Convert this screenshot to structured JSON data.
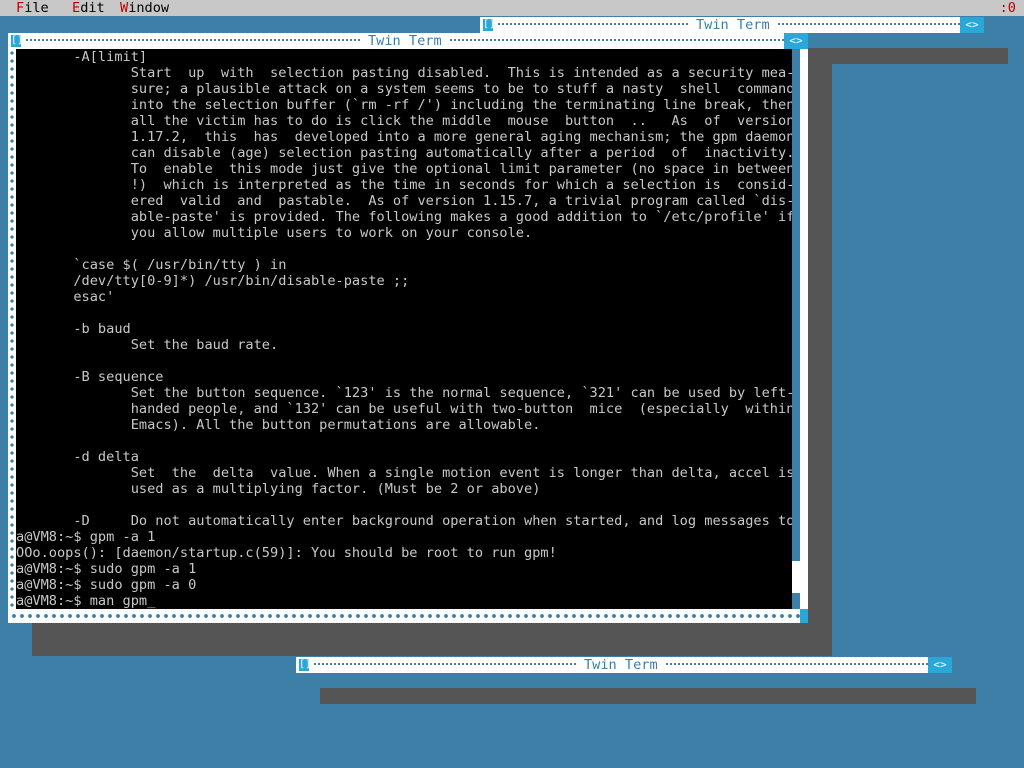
{
  "menu": {
    "file": {
      "hotkey": "F",
      "rest": "ile"
    },
    "edit": {
      "hotkey": "E",
      "rest": "dit"
    },
    "window": {
      "hotkey": "W",
      "rest": "indow"
    },
    "clock": ":0"
  },
  "windows": {
    "top": {
      "title": "Twin Term",
      "close_glyph": "[]",
      "buttons_glyph": "<>"
    },
    "main": {
      "title": "Twin Term",
      "close_glyph": "[]",
      "buttons_glyph": "<>"
    },
    "bottom": {
      "title": "Twin Term",
      "close_glyph": "[]",
      "buttons_glyph": "<>"
    }
  },
  "terminal": {
    "lines": [
      "       -A[limit]",
      "              Start  up  with  selection pasting disabled.  This is intended as a security mea-",
      "              sure; a plausible attack on a system seems to be to stuff a nasty  shell  command",
      "              into the selection buffer (`rm -rf /') including the terminating line break, then",
      "              all the victim has to do is click the middle  mouse  button  ..   As  of  version",
      "              1.17.2,  this  has  developed into a more general aging mechanism; the gpm daemon",
      "              can disable (age) selection pasting automatically after a period  of  inactivity.",
      "              To  enable  this mode just give the optional limit parameter (no space in between",
      "              !)  which is interpreted as the time in seconds for which a selection is  consid-",
      "              ered  valid  and  pastable.  As of version 1.15.7, a trivial program called `dis-",
      "              able-paste' is provided. The following makes a good addition to `/etc/profile' if",
      "              you allow multiple users to work on your console.",
      "",
      "       `case $( /usr/bin/tty ) in",
      "       /dev/tty[0-9]*) /usr/bin/disable-paste ;;",
      "       esac'",
      "",
      "       -b baud",
      "              Set the baud rate.",
      "",
      "       -B sequence",
      "              Set the button sequence. `123' is the normal sequence, `321' can be used by left-",
      "              handed people, and `132' can be useful with two-button  mice  (especially  within",
      "              Emacs). All the button permutations are allowable.",
      "",
      "       -d delta",
      "              Set  the  delta  value. When a single motion event is longer than delta, accel is",
      "              used as a multiplying factor. (Must be 2 or above)",
      "",
      "       -D     Do not automatically enter background operation when started, and log messages to",
      "a@VM8:~$ gpm -a 1",
      "OOo.oops(): [daemon/startup.c(59)]: You should be root to run gpm!",
      "a@VM8:~$ sudo gpm -a 1",
      "a@VM8:~$ sudo gpm -a 0",
      "a@VM8:~$ man gpm"
    ],
    "cursor": "_"
  },
  "colors": {
    "desktop": "#3d7fa6",
    "menubar": "#c8c8c8",
    "accent": "#29a7d8",
    "terminal_bg": "#000000",
    "terminal_fg": "#c8c8c8",
    "hotkey": "#c00000"
  }
}
